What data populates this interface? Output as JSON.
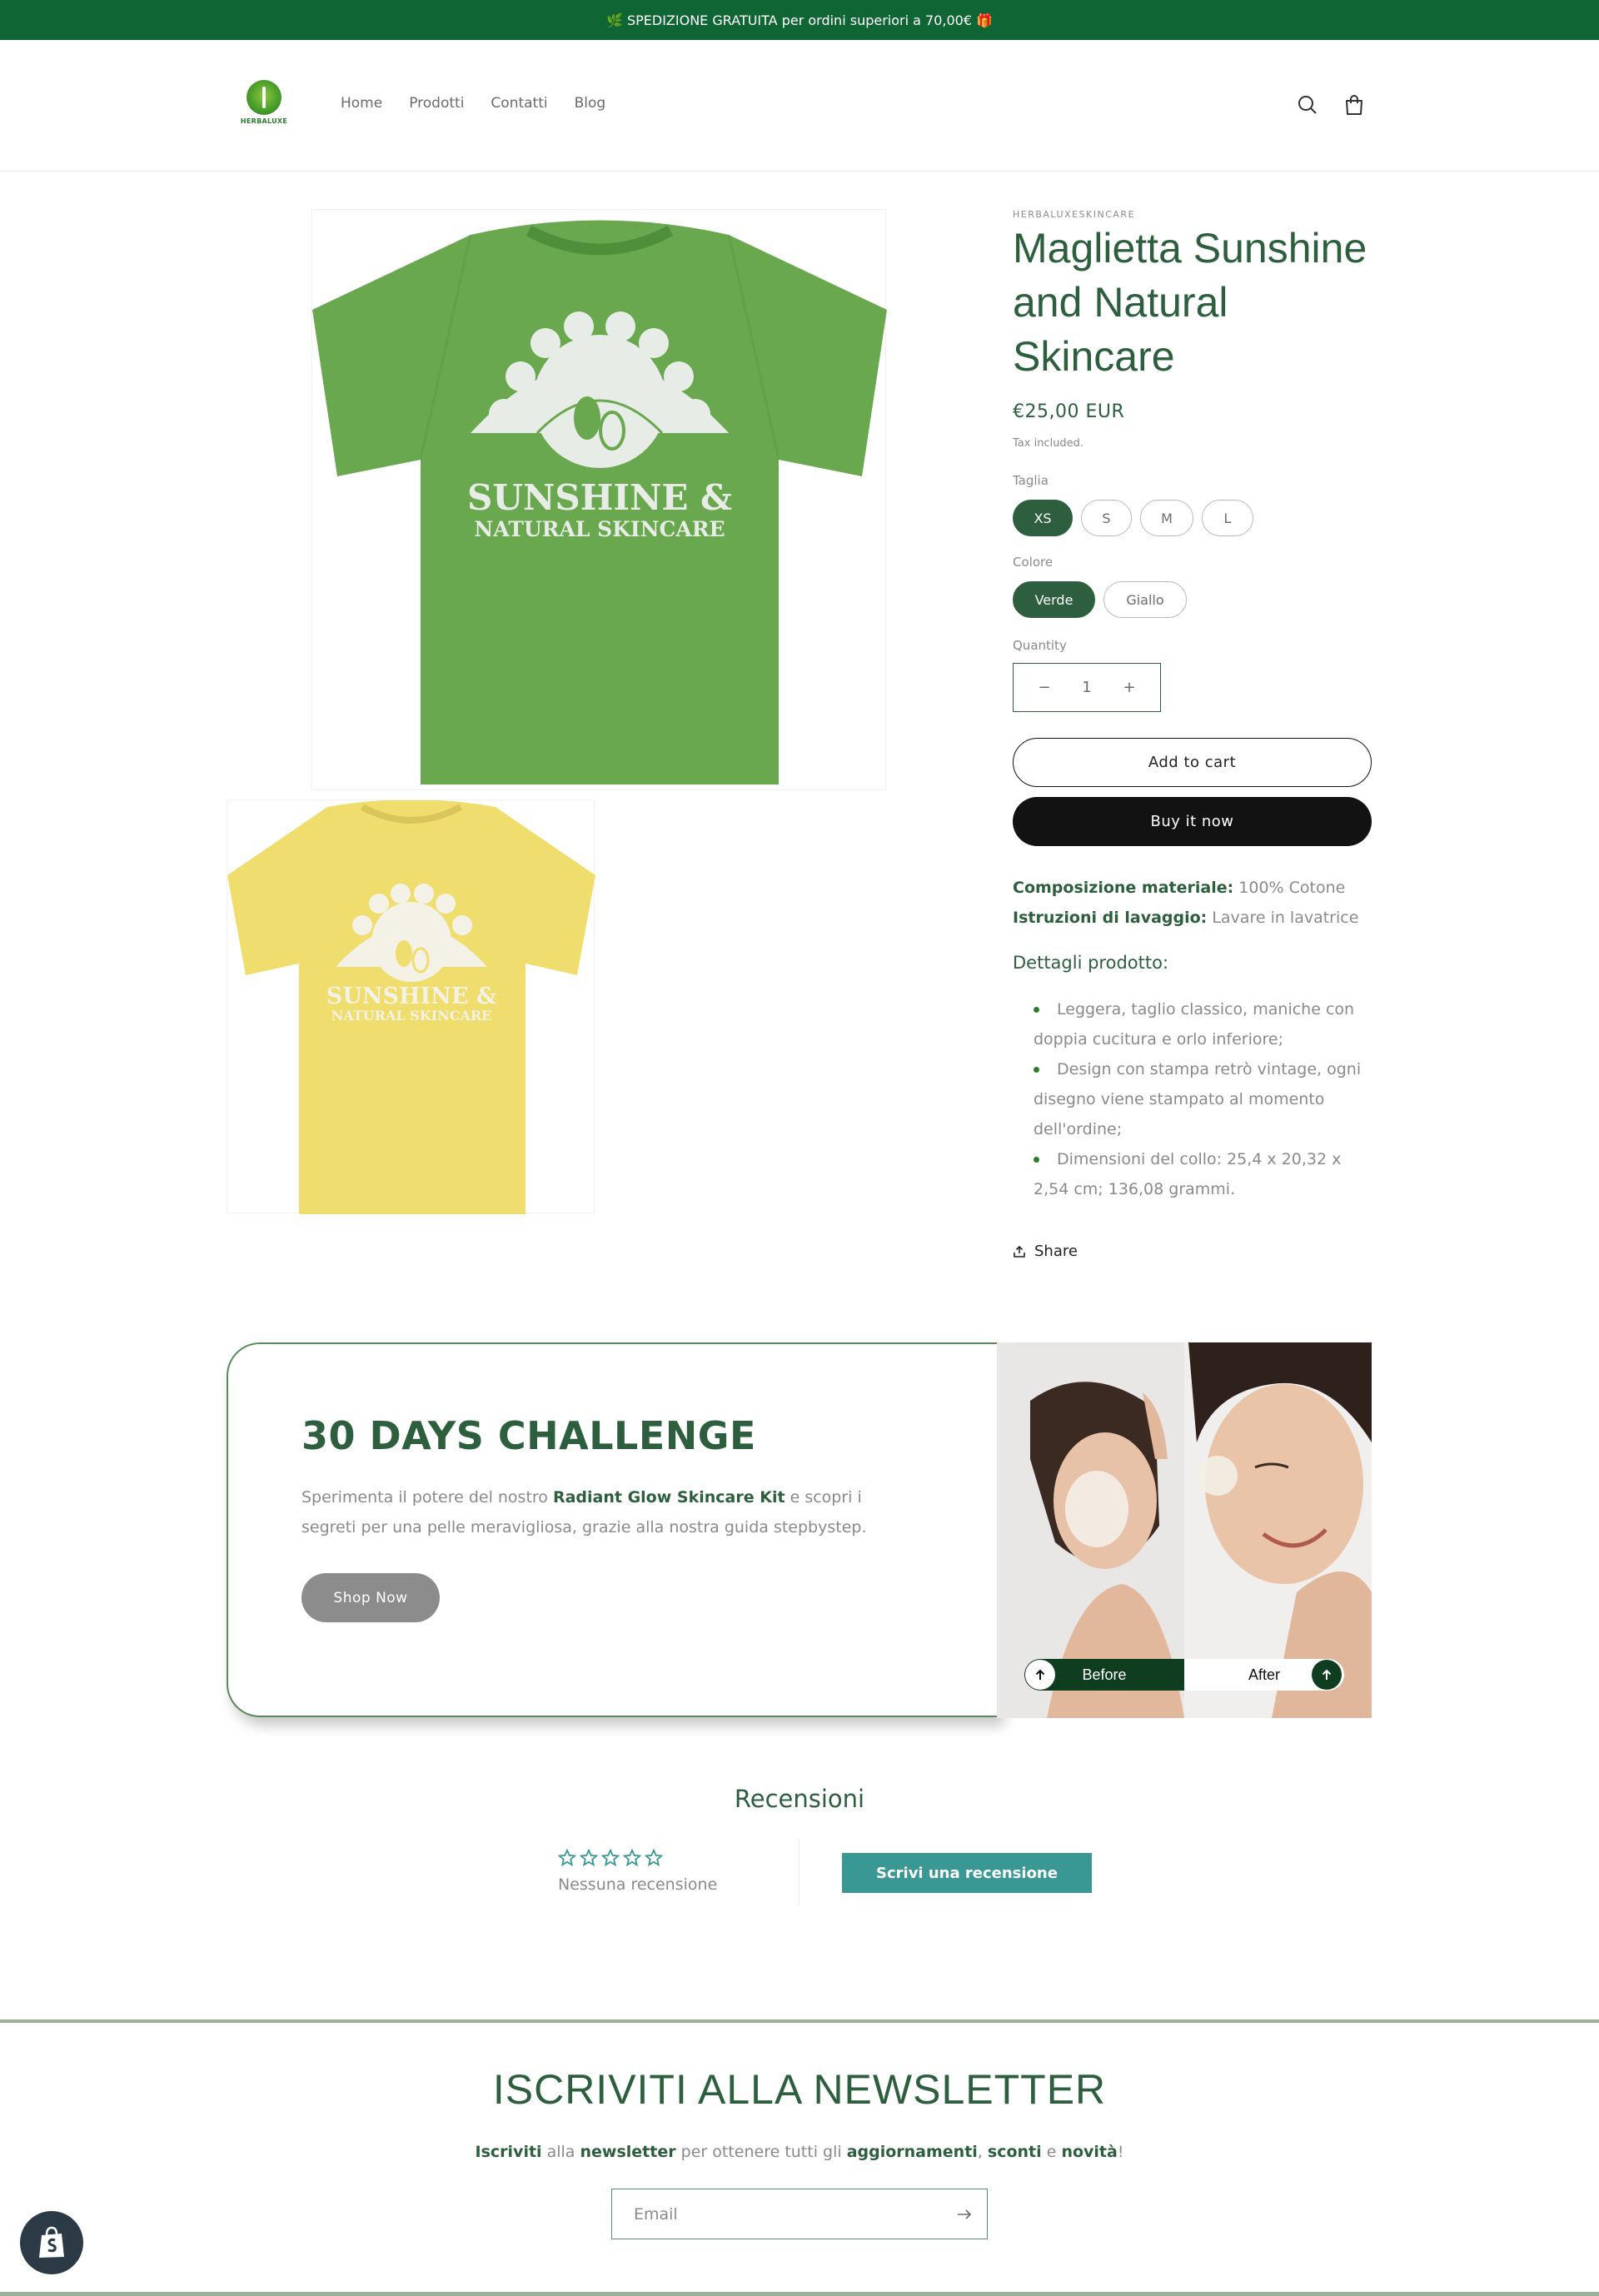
{
  "announcement": {
    "text": "🌿 SPEDIZIONE GRATUITA per ordini superiori a 70,00€ 🎁"
  },
  "header": {
    "logo_text": "HERBALUXE",
    "nav": [
      "Home",
      "Prodotti",
      "Contatti",
      "Blog"
    ],
    "icons": [
      "search-icon",
      "cart-icon"
    ]
  },
  "product": {
    "vendor": "HERBALUXESKINCARE",
    "title": "Maglietta Sunshine and Natural Skincare",
    "price": "€25,00 EUR",
    "tax_note": "Tax included.",
    "images": [
      {
        "name": "green-tshirt",
        "color": "#6aa84f",
        "print_line1": "SUNSHINE &",
        "print_line2": "NATURAL SKINCARE"
      },
      {
        "name": "yellow-tshirt",
        "color": "#efdd6e",
        "print_line1": "SUNSHINE &",
        "print_line2": "NATURAL SKINCARE"
      }
    ],
    "size_label": "Taglia",
    "sizes": [
      "XS",
      "S",
      "M",
      "L"
    ],
    "size_selected": "XS",
    "color_label": "Colore",
    "colors": [
      "Verde",
      "Giallo"
    ],
    "color_selected": "Verde",
    "quantity_label": "Quantity",
    "quantity": "1",
    "add_to_cart": "Add to cart",
    "buy_now": "Buy it now",
    "material_label": "Composizione materiale:",
    "material_value": "100% Cotone",
    "wash_label": "Istruzioni di lavaggio:",
    "wash_value": "Lavare in lavatrice",
    "details_heading": "Dettagli prodotto:",
    "details": [
      "Leggera, taglio classico, maniche con doppia cucitura e orlo inferiore;",
      "Design con stampa retrò vintage, ogni disegno viene stampato al momento dell'ordine;",
      "Dimensioni del collo:  25,4 x 20,32 x 2,54 cm; 136,08 grammi."
    ],
    "share": "Share"
  },
  "challenge": {
    "title": "30 DAYS CHALLENGE",
    "text_before": "Sperimenta il potere del nostro ",
    "text_bold": "Radiant Glow Skincare Kit",
    "text_after": " e scopri i segreti per una pelle meravigliosa, grazie alla nostra guida stepbystep.",
    "button": "Shop Now",
    "before_label": "Before",
    "after_label": "After"
  },
  "reviews": {
    "title": "Recensioni",
    "stars": 0,
    "none_text": "Nessuna recensione",
    "write_button": "Scrivi una recensione"
  },
  "newsletter": {
    "title": "ISCRIVITI ALLA NEWSLETTER",
    "sub_parts": [
      {
        "text": "Iscriviti",
        "bold": true
      },
      {
        "text": " alla ",
        "bold": false
      },
      {
        "text": "newsletter",
        "bold": true
      },
      {
        "text": " per ottenere tutti gli ",
        "bold": false
      },
      {
        "text": "aggiornamenti",
        "bold": true
      },
      {
        "text": ", ",
        "bold": false
      },
      {
        "text": "sconti",
        "bold": true
      },
      {
        "text": " e ",
        "bold": false
      },
      {
        "text": "novità",
        "bold": true
      },
      {
        "text": "!",
        "bold": false
      }
    ],
    "email_placeholder": "Email"
  },
  "colors": {
    "brand_green": "#0f6634",
    "text_green": "#2d5f3f",
    "review_button": "#3a9894"
  }
}
